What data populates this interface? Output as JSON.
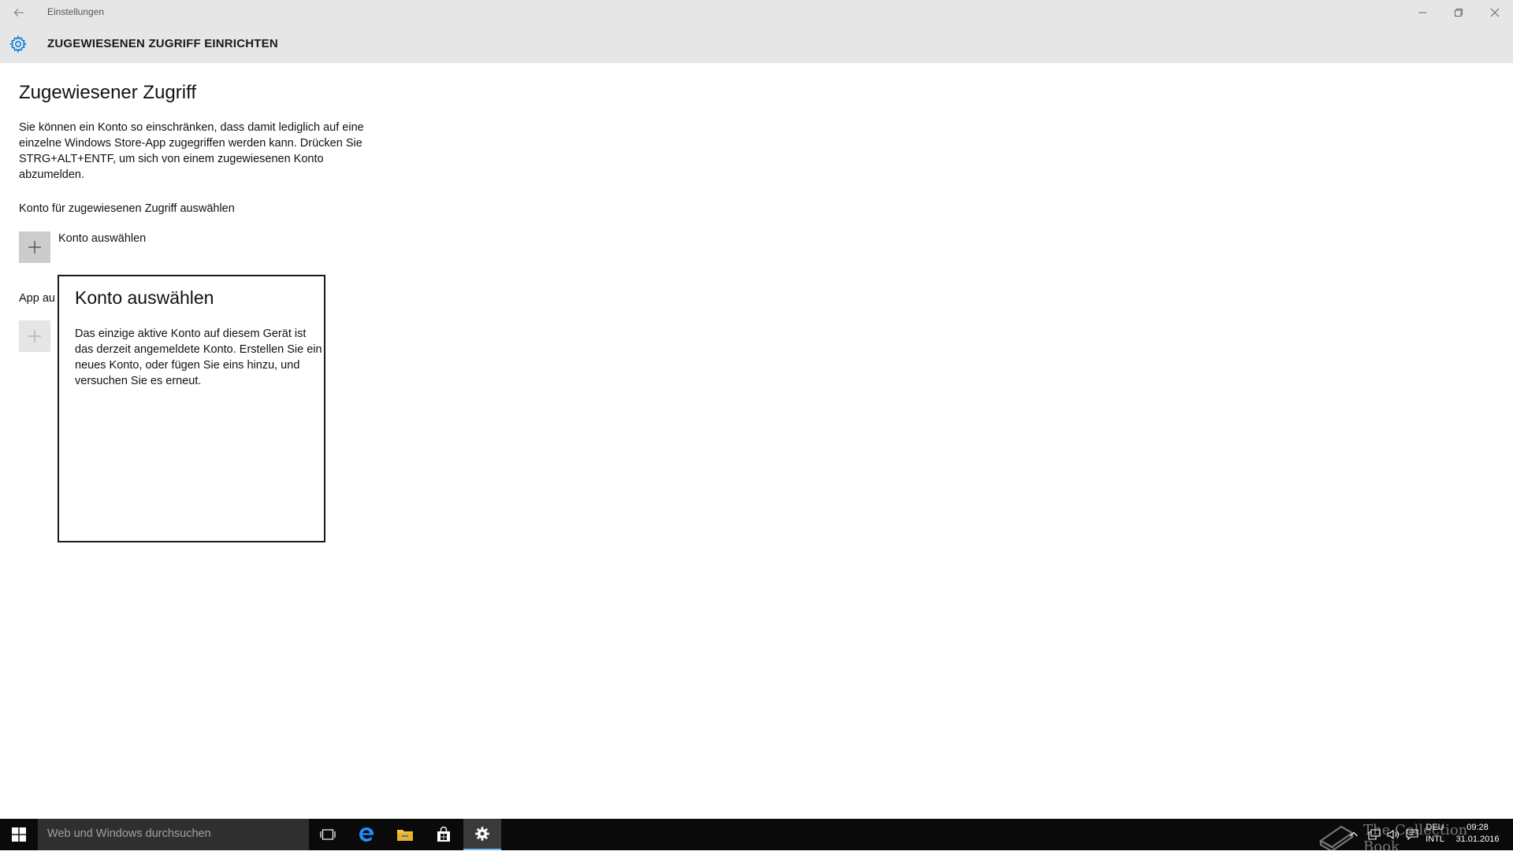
{
  "titlebar": {
    "app_title": "Einstellungen",
    "minimize": "minimize-icon",
    "maximize": "restore-icon",
    "close": "close-icon"
  },
  "header": {
    "title": "ZUGEWIESENEN ZUGRIFF EINRICHTEN",
    "icon": "gear-icon"
  },
  "main": {
    "heading": "Zugewiesener Zugriff",
    "description": "Sie können ein Konto so einschränken, dass damit lediglich auf eine einzelne Windows Store-App zugegriffen werden kann. Drücken Sie STRG+ALT+ENTF, um sich von einem zugewiesenen Konto abzumelden.",
    "account_section_label": "Konto für zugewiesenen Zugriff auswählen",
    "choose_account_label": "Konto auswählen",
    "app_section_label_visible": "App au"
  },
  "flyout": {
    "title": "Konto auswählen",
    "text": "Das einzige aktive Konto auf diesem Gerät ist das derzeit angemeldete Konto. Erstellen Sie ein neues Konto, oder fügen Sie eins hinzu, und versuchen Sie es erneut."
  },
  "taskbar": {
    "search_placeholder": "Web und Windows durchsuchen",
    "apps": [
      "task-view-icon",
      "edge-icon",
      "file-explorer-icon",
      "store-icon",
      "settings-icon"
    ],
    "active_app": "settings-icon",
    "language_top": "DEU",
    "language_bottom": "INTL",
    "time": "09:28",
    "date": "31.01.2016"
  },
  "watermark": {
    "text": "The Collection Book"
  },
  "colors": {
    "header_bg": "#e6e6e6",
    "accent": "#0078d7",
    "taskbar_bg": "#0a0a0a",
    "active_indicator": "#76b9ed"
  }
}
